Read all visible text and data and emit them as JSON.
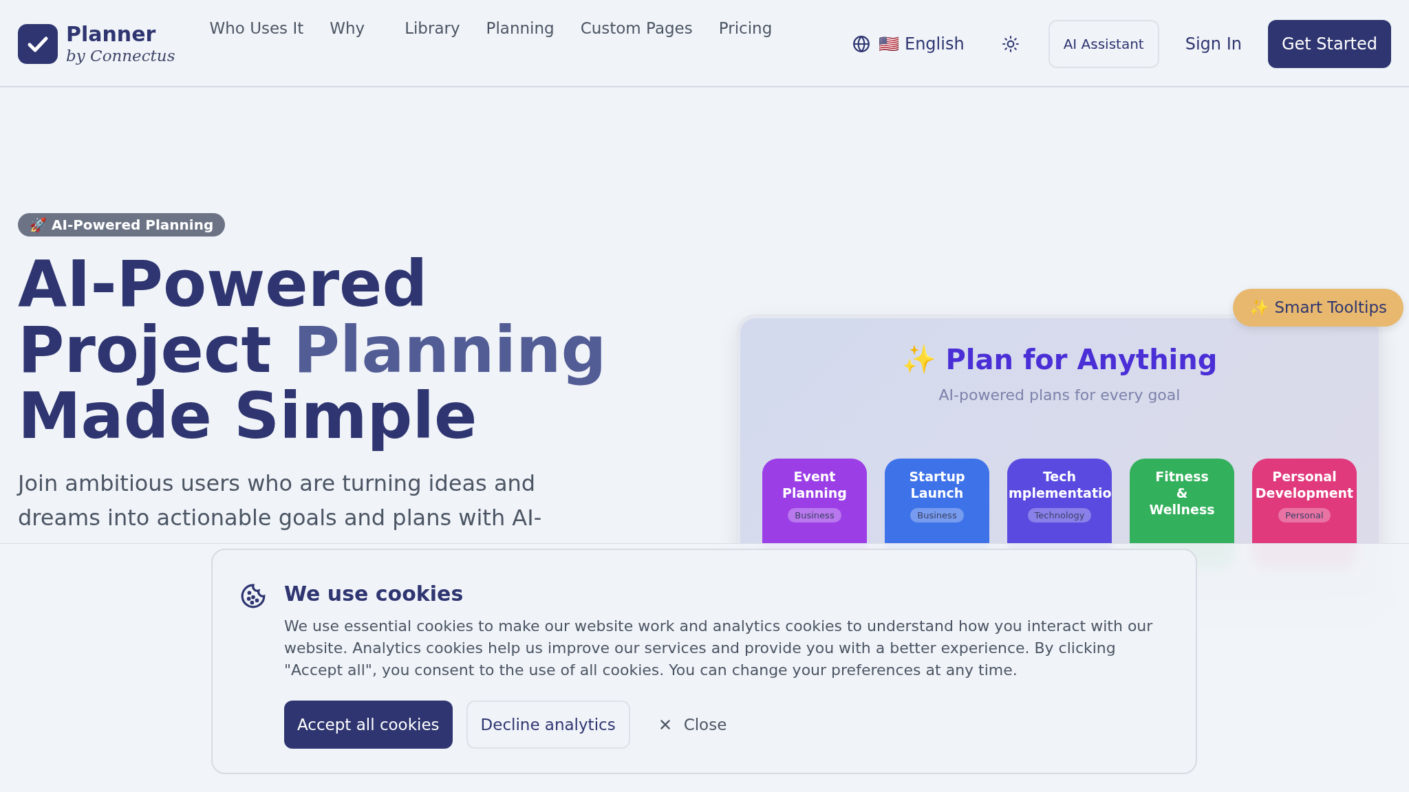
{
  "header": {
    "logo": {
      "title": "Planner",
      "subtitle": "by Connectus"
    },
    "nav": [
      "Who Uses It",
      "Why",
      "Library",
      "Planning",
      "Custom Pages",
      "Pricing"
    ],
    "language": {
      "flag": "🇺🇸",
      "label": "English"
    },
    "assistant": "AI Assistant",
    "sign_in": "Sign In",
    "get_started": "Get Started"
  },
  "hero": {
    "badge": "🚀 AI-Powered Planning",
    "headline": [
      [
        {
          "text": "AI-Powered",
          "accent": false
        }
      ],
      [
        {
          "text": "Project ",
          "accent": false
        },
        {
          "text": "Planning",
          "accent": true
        }
      ],
      [
        {
          "text": "Made Simple",
          "accent": false
        }
      ]
    ],
    "paragraph": "Join ambitious users who are turning ideas and dreams into actionable goals and plans with AI-"
  },
  "showcase": {
    "tooltip": "✨ Smart Tooltips",
    "title_icon": "✨",
    "title": "Plan for Anything",
    "subtitle": "AI-powered plans for every goal",
    "cards": [
      {
        "title": "Event Planning",
        "tag": "Business",
        "color": "#9b3ee6"
      },
      {
        "title": "Startup Launch",
        "tag": "Business",
        "color": "#3d72e8"
      },
      {
        "title": "Tech mplementatio",
        "tag": "Technology",
        "color": "#5a4ae0"
      },
      {
        "title": "Fitness & Wellness",
        "color": "#33b05c"
      },
      {
        "title": "Personal Development",
        "tag": "Personal",
        "color": "#e0397c"
      }
    ]
  },
  "cookie_banner": {
    "title": "We use cookies",
    "text": "We use essential cookies to make our website work and analytics cookies to understand how you interact with our website. Analytics cookies help us improve our services and provide you with a better experience. By clicking \"Accept all\", you consent to the use of all cookies. You can change your preferences at any time.",
    "buttons": [
      {
        "label": "Accept all cookies",
        "kind": "primary"
      },
      {
        "label": "Decline analytics",
        "kind": "secondary"
      },
      {
        "label": "Close",
        "kind": "close"
      }
    ]
  }
}
